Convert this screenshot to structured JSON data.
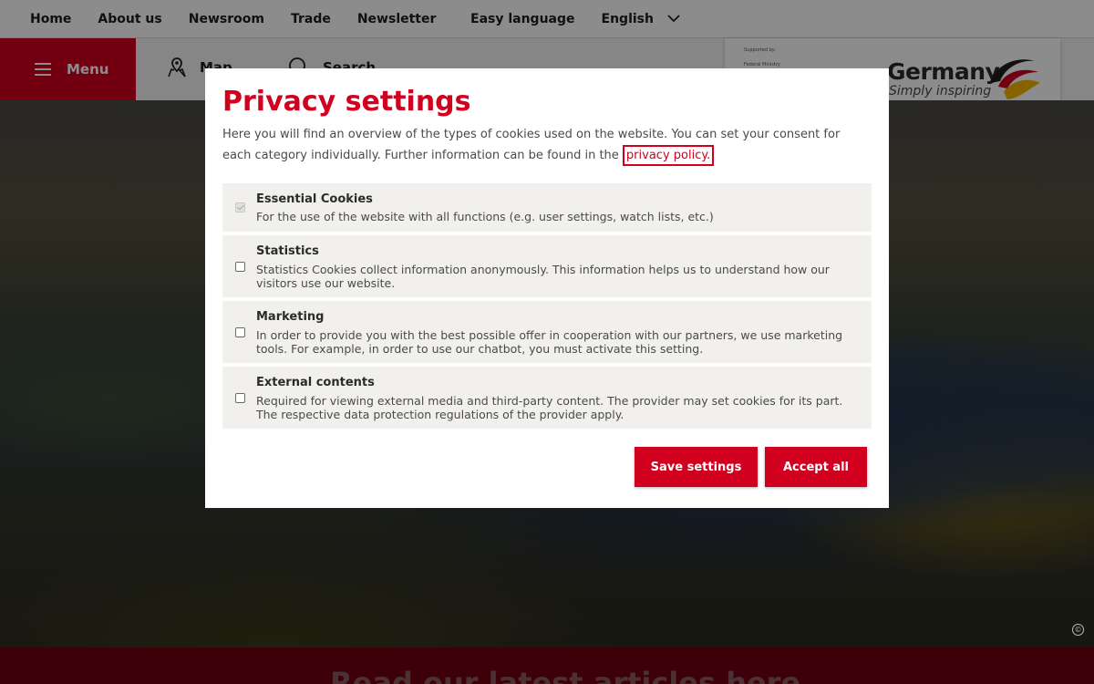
{
  "topbar": {
    "nav": [
      "Home",
      "About us",
      "Newsroom",
      "Trade",
      "Newsletter"
    ],
    "easy_language": "Easy language",
    "language": "English"
  },
  "header": {
    "menu_label": "Menu",
    "map_label": "Map",
    "search_label": "Search",
    "logo": {
      "supported_by": "Supported by:",
      "ministry": "Federal Ministry",
      "name": "Germany",
      "tagline": "Simply inspiring"
    }
  },
  "footer": {
    "headline": "Read our latest articles here"
  },
  "modal": {
    "title": "Privacy settings",
    "intro_text": "Here you will find an overview of the types of cookies used on the website. You can set your consent for each category individually. Further information can be found in the ",
    "privacy_link": "privacy policy.",
    "categories": [
      {
        "title": "Essential Cookies",
        "desc": "For the use of the website with all functions (e.g. user settings, watch lists, etc.)",
        "checked": true,
        "disabled": true
      },
      {
        "title": "Statistics",
        "desc": "Statistics Cookies collect information anonymously. This information helps us to understand how our visitors use our website.",
        "checked": false,
        "disabled": false
      },
      {
        "title": "Marketing",
        "desc": "In order to provide you with the best possible offer in cooperation with our partners, we use marketing tools. For example, in order to use our chatbot, you must activate this setting.",
        "checked": false,
        "disabled": false
      },
      {
        "title": "External contents",
        "desc": "Required for viewing external media and third-party content. The provider may set cookies for its part. The respective data protection regulations of the provider apply.",
        "checked": false,
        "disabled": false
      }
    ],
    "save_label": "Save settings",
    "accept_label": "Accept all"
  },
  "colors": {
    "brand_red": "#d1001f"
  }
}
